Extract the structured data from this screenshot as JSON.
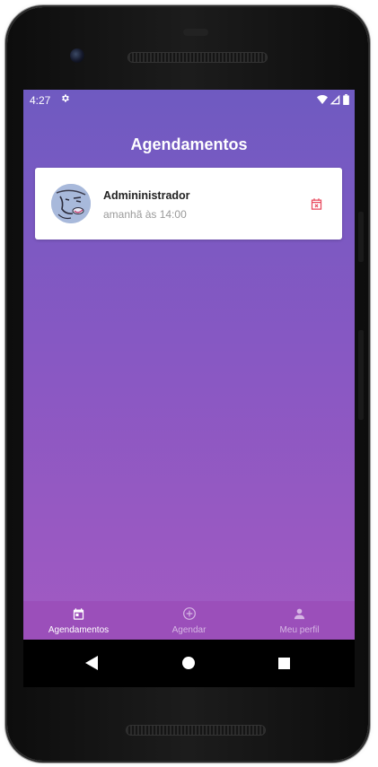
{
  "status_bar": {
    "time": "4:27"
  },
  "header": {
    "title": "Agendamentos"
  },
  "appointments": [
    {
      "name": "Admininistrador",
      "time": "amanhã às 14:00"
    }
  ],
  "tabs": [
    {
      "label": "Agendamentos",
      "icon": "calendar-icon",
      "active": true
    },
    {
      "label": "Agendar",
      "icon": "add-circle-icon",
      "active": false
    },
    {
      "label": "Meu perfil",
      "icon": "person-icon",
      "active": false
    }
  ],
  "colors": {
    "gradient_top": "#6f5ac1",
    "gradient_bottom": "#a65ac1",
    "tab_bar": "#9b4fba",
    "cancel_icon": "#e8475c"
  }
}
